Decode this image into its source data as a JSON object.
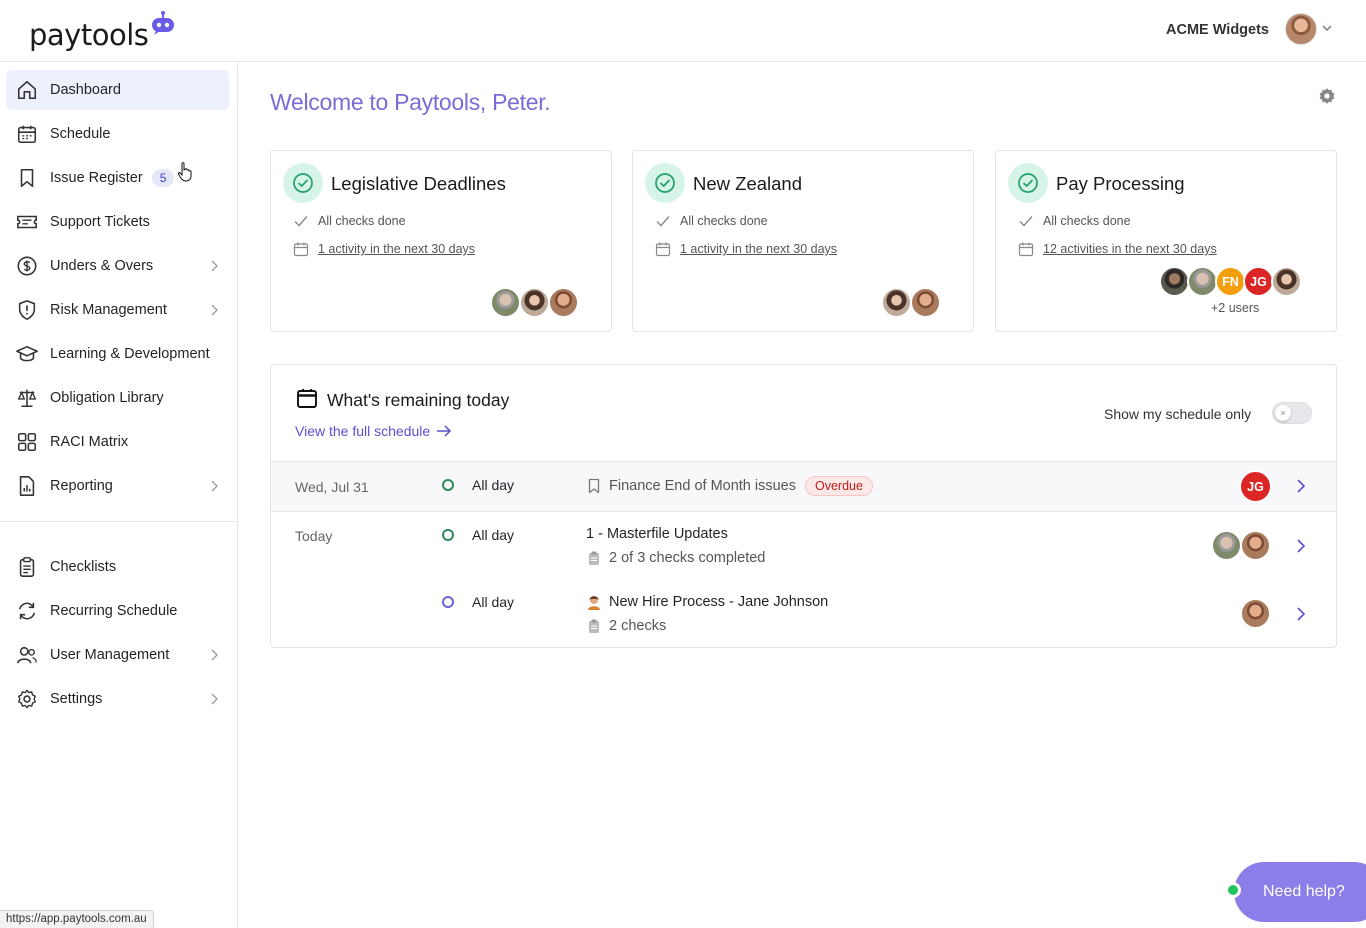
{
  "header": {
    "logo_text": "paytools",
    "org_name": "ACME Widgets"
  },
  "sidebar": {
    "items": [
      {
        "label": "Dashboard",
        "icon": "home-icon",
        "active": true
      },
      {
        "label": "Schedule",
        "icon": "calendar-icon"
      },
      {
        "label": "Issue Register",
        "icon": "bookmark-icon",
        "badge": "5"
      },
      {
        "label": "Support Tickets",
        "icon": "ticket-icon"
      },
      {
        "label": "Unders & Overs",
        "icon": "dollar-icon",
        "has_children": true
      },
      {
        "label": "Risk Management",
        "icon": "shield-icon",
        "has_children": true
      },
      {
        "label": "Learning & Development",
        "icon": "graduation-cap-icon"
      },
      {
        "label": "Obligation Library",
        "icon": "scales-icon"
      },
      {
        "label": "RACI Matrix",
        "icon": "grid-icon"
      },
      {
        "label": "Reporting",
        "icon": "report-icon",
        "has_children": true
      }
    ],
    "secondary_items": [
      {
        "label": "Checklists",
        "icon": "clipboard-icon"
      },
      {
        "label": "Recurring Schedule",
        "icon": "recurring-icon"
      },
      {
        "label": "User Management",
        "icon": "users-icon",
        "has_children": true
      },
      {
        "label": "Settings",
        "icon": "gear-icon",
        "has_children": true
      }
    ]
  },
  "main": {
    "welcome": "Welcome to Paytools, Peter.",
    "cards": [
      {
        "title": "Legislative Deadlines",
        "status": "All checks done",
        "activity_link": "1 activity in the next 30 days",
        "avatars": [
          "photo",
          "photo",
          "photo"
        ]
      },
      {
        "title": "New Zealand",
        "status": "All checks done",
        "activity_link": "1 activity in the next 30 days",
        "avatars": [
          "photo",
          "photo"
        ]
      },
      {
        "title": "Pay Processing",
        "status": "All checks done",
        "activity_link": "12 activities in the next 30 days",
        "avatars": [
          "photo",
          "photo",
          "FN",
          "JG",
          "photo"
        ],
        "more_users": "+2 users"
      }
    ],
    "schedule": {
      "title": "What's remaining today",
      "view_link": "View the full schedule",
      "toggle_label": "Show my schedule only",
      "toggle_on": false,
      "rows": [
        {
          "date": "Wed, Jul 31",
          "time": "All day",
          "title": "Finance End of Month issues",
          "badge": "Overdue",
          "assignee_initials": "JG"
        },
        {
          "date": "Today",
          "time": "All day",
          "title": "1 - Masterfile Updates",
          "sub": "2 of 3 checks completed"
        },
        {
          "date": "",
          "time": "All day",
          "title": "New Hire Process - Jane Johnson",
          "sub": "2 checks"
        }
      ]
    }
  },
  "help_button": "Need help?",
  "status_url": "https://app.paytools.com.au",
  "colors": {
    "accent": "#7c6bd6",
    "link": "#5b4fd0",
    "active_nav_bg": "#eef0fc",
    "success_bg": "#d6f5e8",
    "danger": "#dc2626",
    "warning": "#f59e0b"
  }
}
